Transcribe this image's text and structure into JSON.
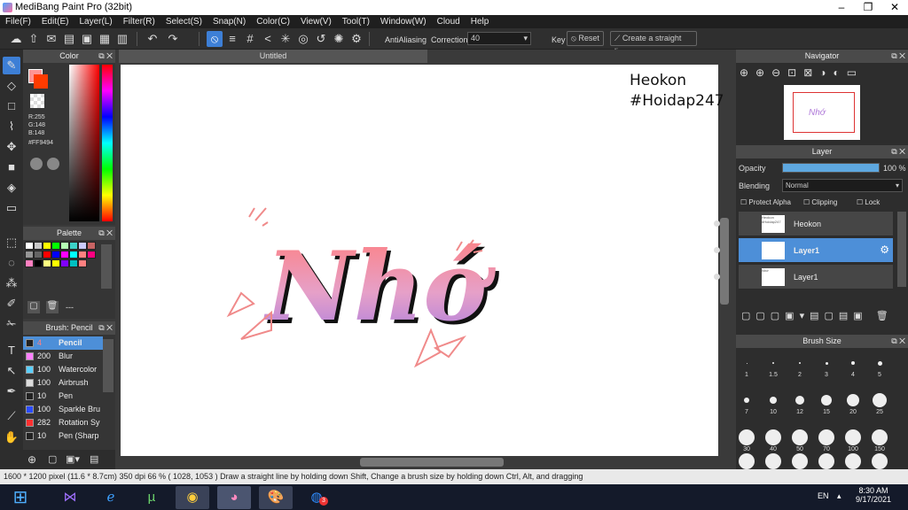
{
  "window": {
    "title": "MediBang Paint Pro (32bit)"
  },
  "menu": [
    "File(F)",
    "Edit(E)",
    "Layer(L)",
    "Filter(R)",
    "Select(S)",
    "Snap(N)",
    "Color(C)",
    "View(V)",
    "Tool(T)",
    "Window(W)",
    "Cloud",
    "Help"
  ],
  "toolbar": {
    "antialiasing": "AntiAliasing",
    "correction_label": "Correction",
    "correction_value": "40",
    "key_label": "Key",
    "reset_label": "Reset",
    "straight_line_label": "Create a straight line"
  },
  "document": {
    "tab_title": "Untitled",
    "text_line1": "Heokon",
    "text_line2": "#Hoidap247",
    "art_text": "Nhớ"
  },
  "color_panel": {
    "title": "Color",
    "r": "R:255",
    "g": "G:148",
    "b": "B:148",
    "hex": "#FF9494",
    "main_color": "#FF9494"
  },
  "palette_panel": {
    "title": "Palette",
    "dash": "---",
    "swatches": [
      "#ffffff",
      "#c8c8c8",
      "#fffe00",
      "#00ff00",
      "#b4ffb4",
      "#3cd2c8",
      "#ccccff",
      "#c86464",
      "#969696",
      "#646464",
      "#ff0000",
      "#0000ff",
      "#ff00ff",
      "#00ffff",
      "#ff8080",
      "#ff0080",
      "#ff80c0",
      "#000000",
      "#ffff80",
      "#ffff00",
      "#8000ff",
      "#00c0c0",
      "#ff8080"
    ]
  },
  "brush_panel": {
    "title": "Brush: Pencil",
    "items": [
      {
        "size": "4",
        "name": "Pencil",
        "color": "#222222"
      },
      {
        "size": "200",
        "name": "Blur",
        "color": "#ff80ff"
      },
      {
        "size": "100",
        "name": "Watercolor",
        "color": "#5ad0ff"
      },
      {
        "size": "100",
        "name": "Airbrush",
        "color": "#dddddd"
      },
      {
        "size": "10",
        "name": "Pen",
        "color": "#222222"
      },
      {
        "size": "100",
        "name": "Sparkle Bru",
        "color": "#2a4cff"
      },
      {
        "size": "282",
        "name": "Rotation Sy",
        "color": "#ff3030"
      },
      {
        "size": "10",
        "name": "Pen (Sharp",
        "color": "#222222"
      }
    ]
  },
  "navigator": {
    "title": "Navigator"
  },
  "layer_panel": {
    "title": "Layer",
    "opacity_label": "Opacity",
    "opacity_value": "100 %",
    "opacity_level": 100,
    "blending_label": "Blending",
    "blending_value": "Normal",
    "protect_alpha": "Protect Alpha",
    "clipping": "Clipping",
    "lock": "Lock",
    "layers": [
      {
        "name": "Heokon",
        "thumb": "Heokon #Hoidap247"
      },
      {
        "name": "Layer1",
        "thumb": ""
      },
      {
        "name": "Layer1",
        "thumb": "Nhớ"
      }
    ]
  },
  "brush_size_panel": {
    "title": "Brush Size",
    "row1": [
      "1",
      "1.5",
      "2",
      "3",
      "4",
      "5"
    ],
    "row2": [
      "7",
      "10",
      "12",
      "15",
      "20",
      "25"
    ],
    "row3": [
      "30",
      "40",
      "50",
      "70",
      "100",
      "150"
    ]
  },
  "status": {
    "size": "1600 * 1200 pixel",
    "cm": "(11.6 * 8.7cm)",
    "dpi": "350 dpi",
    "zoom": "66 %",
    "coords": "( 1028, 1053 )",
    "hint": "Draw a straight line by holding down Shift, Change a brush size by holding down Ctrl, Alt, and dragging"
  },
  "taskbar": {
    "lang": "EN",
    "time": "8:30 AM",
    "date": "9/17/2021",
    "zalo_badge": "3"
  }
}
